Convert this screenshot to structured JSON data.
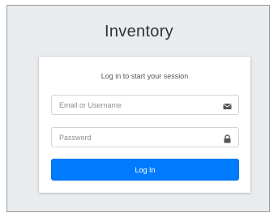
{
  "app": {
    "title": "Inventory"
  },
  "login": {
    "subtitle": "Log in to start your session",
    "email": {
      "placeholder": "Email or Username",
      "value": "",
      "icon": "envelope-icon"
    },
    "password": {
      "placeholder": "Password",
      "value": "",
      "icon": "lock-icon"
    },
    "submit_label": "Log In"
  },
  "colors": {
    "page_background": "#e9ecef",
    "card_background": "#ffffff",
    "primary_button": "#007bff",
    "icon": "#555555"
  }
}
